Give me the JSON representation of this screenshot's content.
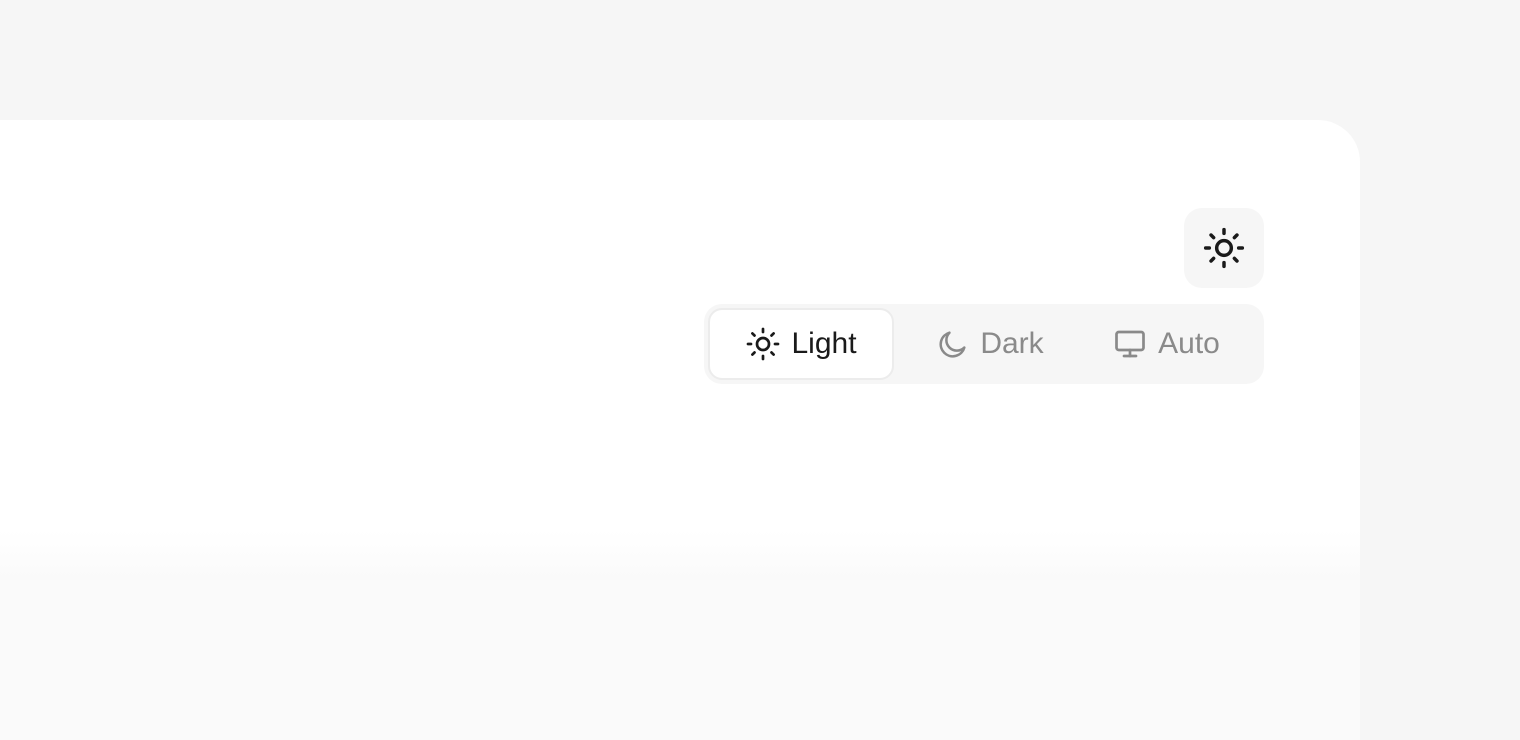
{
  "theme_switcher": {
    "current_icon": "sun-icon",
    "options": [
      {
        "label": "Light",
        "icon": "sun-icon",
        "active": true
      },
      {
        "label": "Dark",
        "icon": "moon-icon",
        "active": false
      },
      {
        "label": "Auto",
        "icon": "monitor-icon",
        "active": false
      }
    ]
  },
  "colors": {
    "page_background": "#f6f6f6",
    "card_background": "#ffffff",
    "active_text": "#1a1a1a",
    "inactive_text": "#8a8a8a"
  }
}
